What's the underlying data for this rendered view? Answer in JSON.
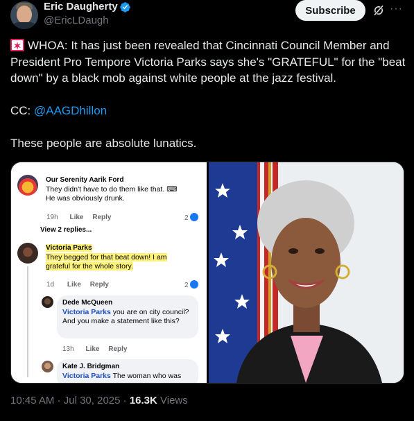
{
  "author": {
    "name": "Eric Daugherty",
    "handle": "@EricLDaugh"
  },
  "header": {
    "subscribe_label": "Subscribe",
    "more_label": "···"
  },
  "tweet": {
    "line1": "WHOA: It has just been revealed that Cincinnati Council Member and President Pro Tempore Victoria Parks says she's \"GRATEFUL\" for the \"beat down\" by a black mob against white people at the jazz festival.",
    "cc_prefix": "CC: ",
    "cc_mention": "@AAGDhillon",
    "line3": "These people are absolute lunatics."
  },
  "screenshot_comments": [
    {
      "name": "Our Serenity Aarik Ford",
      "text": "They didn't have to do them like that. ⌨\nHe was obviously drunk.",
      "time": "19h",
      "like": "Like",
      "reply": "Reply",
      "count": "2"
    },
    {
      "view_replies": "View 2 replies..."
    },
    {
      "name": "Victoria Parks",
      "text": "They begged for that beat down! I am grateful for the whole story.",
      "time": "1d",
      "like": "Like",
      "reply": "Reply",
      "count": "2"
    },
    {
      "name": "Dede McQueen",
      "mention": "Victoria Parks",
      "text": " you are on city council? And you make a statement like this?",
      "time": "13h",
      "like": "Like",
      "reply": "Reply"
    },
    {
      "name": "Kate J. Bridgman",
      "mention": "Victoria Parks",
      "text": " The woman who was"
    }
  ],
  "footer": {
    "time": "10:45 AM",
    "sep1": " · ",
    "date": "Jul 30, 2025",
    "sep2": " · ",
    "views_count": "16.3K",
    "views_label": " Views"
  },
  "colors": {
    "background": "#000000",
    "text": "#e7e9ea",
    "muted": "#71767b",
    "link": "#1d9bf0",
    "verified": "#1d9bf0",
    "highlight": "#fff27a"
  }
}
